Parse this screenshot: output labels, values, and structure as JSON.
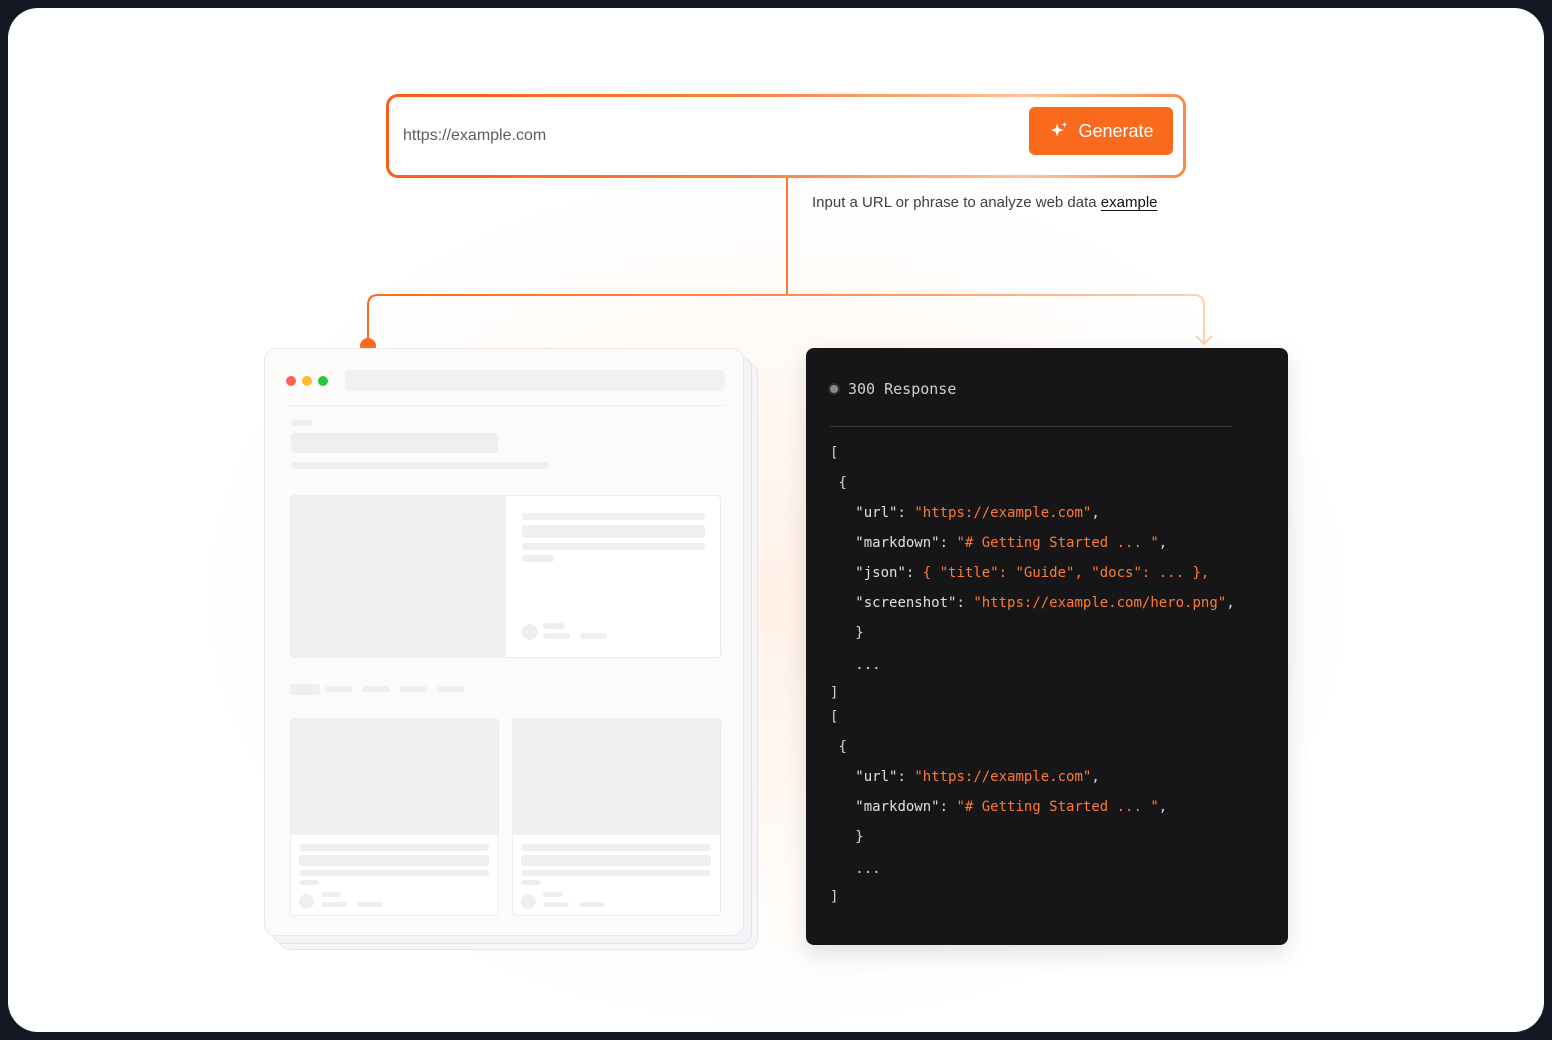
{
  "url_form": {
    "placeholder": "https://example.com",
    "generate_label": "Generate",
    "generate_icon": "sparkle-icon"
  },
  "hint": {
    "text": "Input a URL or phrase to analyze web data ",
    "link_label": "example"
  },
  "browser_mock": {
    "traffic_lights": [
      "#ff5f57",
      "#febc2e",
      "#28c840"
    ]
  },
  "response": {
    "status_text": "300 Response",
    "lines": [
      {
        "indent": "",
        "parts": [
          {
            "t": "punc",
            "v": "["
          }
        ]
      },
      {
        "indent": " ",
        "parts": [
          {
            "t": "punc",
            "v": "{"
          }
        ]
      },
      {
        "indent": "   ",
        "parts": [
          {
            "t": "key",
            "v": "\"url\""
          },
          {
            "t": "punc",
            "v": ": "
          },
          {
            "t": "str",
            "v": "\"https://example.com\""
          },
          {
            "t": "punc",
            "v": ","
          }
        ]
      },
      {
        "indent": "   ",
        "parts": [
          {
            "t": "key",
            "v": "\"markdown\""
          },
          {
            "t": "punc",
            "v": ": "
          },
          {
            "t": "str",
            "v": "\"# Getting Started ... \""
          },
          {
            "t": "punc",
            "v": ","
          }
        ]
      },
      {
        "indent": "   ",
        "parts": [
          {
            "t": "key",
            "v": "\"json\""
          },
          {
            "t": "punc",
            "v": ": "
          },
          {
            "t": "str",
            "v": "{ \"title\": \"Guide\", \"docs\": ... },"
          }
        ]
      },
      {
        "indent": "   ",
        "parts": [
          {
            "t": "key",
            "v": "\"screenshot\""
          },
          {
            "t": "punc",
            "v": ": "
          },
          {
            "t": "str",
            "v": "\"https://example.com/hero.png\""
          },
          {
            "t": "punc",
            "v": ","
          }
        ]
      },
      {
        "indent": "   ",
        "parts": [
          {
            "t": "punc",
            "v": "}"
          }
        ]
      },
      {
        "indent": "   ",
        "parts": [
          {
            "t": "punc",
            "v": "..."
          }
        ]
      },
      {
        "indent": "",
        "parts": [
          {
            "t": "punc",
            "v": "]"
          }
        ]
      },
      {
        "indent": "",
        "parts": [
          {
            "t": "punc",
            "v": "["
          }
        ]
      },
      {
        "indent": " ",
        "parts": [
          {
            "t": "punc",
            "v": "{"
          }
        ]
      },
      {
        "indent": "   ",
        "parts": [
          {
            "t": "key",
            "v": "\"url\""
          },
          {
            "t": "punc",
            "v": ": "
          },
          {
            "t": "str",
            "v": "\"https://example.com\""
          },
          {
            "t": "punc",
            "v": ","
          }
        ]
      },
      {
        "indent": "   ",
        "parts": [
          {
            "t": "key",
            "v": "\"markdown\""
          },
          {
            "t": "punc",
            "v": ": "
          },
          {
            "t": "str",
            "v": "\"# Getting Started ... \""
          },
          {
            "t": "punc",
            "v": ","
          }
        ]
      },
      {
        "indent": "   ",
        "parts": [
          {
            "t": "punc",
            "v": "}"
          }
        ]
      },
      {
        "indent": "   ",
        "parts": [
          {
            "t": "punc",
            "v": "..."
          }
        ]
      },
      {
        "indent": "",
        "parts": [
          {
            "t": "punc",
            "v": "]"
          }
        ]
      }
    ]
  },
  "colors": {
    "accent": "#fa6a1c",
    "code_bg": "#161619",
    "code_string": "#ff7a33"
  }
}
